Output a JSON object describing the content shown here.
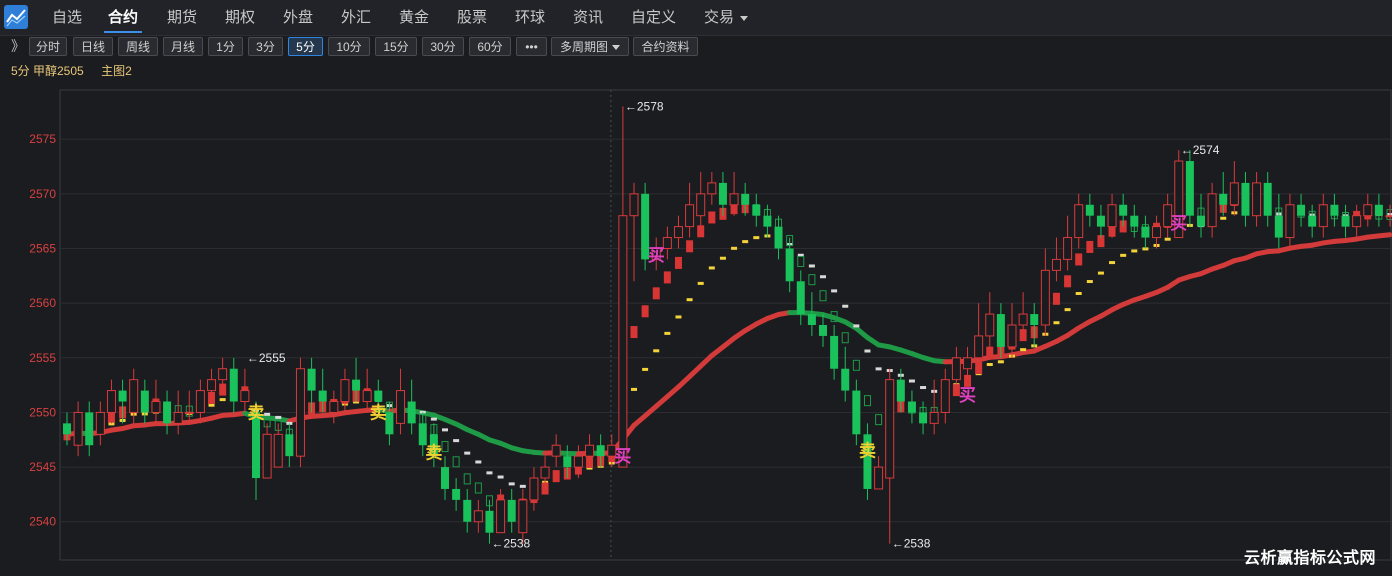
{
  "nav": {
    "items": [
      "自选",
      "合约",
      "期货",
      "期权",
      "外盘",
      "外汇",
      "黄金",
      "股票",
      "环球",
      "资讯",
      "自定义",
      "交易"
    ],
    "active": "合约"
  },
  "toolbar": {
    "expand_glyph": "》",
    "buttons": [
      "分时",
      "日线",
      "周线",
      "月线",
      "1分",
      "3分",
      "5分",
      "10分",
      "15分",
      "30分",
      "60分",
      "•••",
      "多周期图",
      "合约资料"
    ],
    "active": "5分"
  },
  "info": {
    "period_contract": "5分 甲醇2505",
    "main_chart": "主图2"
  },
  "chart_data": {
    "type": "candlestick",
    "y_ticks": [
      2540,
      2545,
      2550,
      2555,
      2560,
      2565,
      2570,
      2575
    ],
    "ylim": [
      2536.5,
      2579.5
    ],
    "grid": true,
    "annotations": [
      {
        "text": "←2555",
        "index": 16,
        "value": 2555
      },
      {
        "text": "←2578",
        "index": 50,
        "value": 2578
      },
      {
        "text": "←2538",
        "index": 38,
        "value": 2538
      },
      {
        "text": "←2538",
        "index": 74,
        "value": 2538
      },
      {
        "text": "←2574",
        "index": 100,
        "value": 2574
      }
    ],
    "signals": [
      {
        "text": "卖",
        "index": 17,
        "value": 2550.2,
        "type": "sell"
      },
      {
        "text": "卖",
        "index": 28,
        "value": 2550.2,
        "type": "sell"
      },
      {
        "text": "卖",
        "index": 33,
        "value": 2546.5,
        "type": "sell"
      },
      {
        "text": "买",
        "index": 50,
        "value": 2546.2,
        "type": "buy"
      },
      {
        "text": "买",
        "index": 53,
        "value": 2564.6,
        "type": "buy"
      },
      {
        "text": "卖",
        "index": 72,
        "value": 2546.7,
        "type": "sell"
      },
      {
        "text": "买",
        "index": 81,
        "value": 2551.8,
        "type": "buy"
      },
      {
        "text": "买",
        "index": 100,
        "value": 2567.5,
        "type": "buy"
      }
    ],
    "candles": [
      [
        2549,
        2548,
        2550,
        2547
      ],
      [
        2547,
        2550,
        2551,
        2546
      ],
      [
        2550,
        2547,
        2551,
        2546
      ],
      [
        2548,
        2550,
        2551,
        2547
      ],
      [
        2550,
        2552,
        2553,
        2549
      ],
      [
        2552,
        2551,
        2553,
        2549
      ],
      [
        2550,
        2553,
        2554,
        2549
      ],
      [
        2552,
        2550,
        2553,
        2549
      ],
      [
        2550,
        2551,
        2553,
        2549
      ],
      [
        2551,
        2549,
        2552,
        2548
      ],
      [
        2549,
        2550,
        2552,
        2548
      ],
      [
        2550,
        2550,
        2552,
        2549
      ],
      [
        2550,
        2552,
        2553,
        2549
      ],
      [
        2552,
        2553,
        2554,
        2551
      ],
      [
        2553,
        2554,
        2555,
        2552
      ],
      [
        2554,
        2551,
        2555,
        2550
      ],
      [
        2551,
        2552,
        2554,
        2550
      ],
      [
        2550,
        2544,
        2551,
        2542
      ],
      [
        2544,
        2548,
        2549,
        2544
      ],
      [
        2545,
        2548,
        2549,
        2545
      ],
      [
        2548,
        2546,
        2549,
        2545
      ],
      [
        2546,
        2554,
        2555,
        2545
      ],
      [
        2554,
        2552,
        2555,
        2550
      ],
      [
        2552,
        2551,
        2554,
        2550
      ],
      [
        2550,
        2551,
        2552,
        2549
      ],
      [
        2551,
        2553,
        2554,
        2550
      ],
      [
        2553,
        2552,
        2555,
        2551
      ],
      [
        2551,
        2552,
        2554,
        2550
      ],
      [
        2552,
        2551,
        2553,
        2550
      ],
      [
        2550,
        2548,
        2551,
        2547
      ],
      [
        2549,
        2552,
        2554,
        2548
      ],
      [
        2551,
        2549,
        2553,
        2548
      ],
      [
        2549,
        2547,
        2550,
        2546
      ],
      [
        2548,
        2546,
        2549,
        2545
      ],
      [
        2545,
        2543,
        2546,
        2542
      ],
      [
        2543,
        2542,
        2544,
        2541
      ],
      [
        2542,
        2540,
        2543,
        2539
      ],
      [
        2540,
        2541,
        2542,
        2539
      ],
      [
        2541,
        2539,
        2542,
        2538
      ],
      [
        2539,
        2542,
        2543,
        2539
      ],
      [
        2542,
        2540,
        2543,
        2539
      ],
      [
        2539,
        2542,
        2543,
        2538
      ],
      [
        2542,
        2544,
        2545,
        2541
      ],
      [
        2544,
        2545,
        2546,
        2543
      ],
      [
        2546,
        2547,
        2548,
        2545
      ],
      [
        2546,
        2545,
        2547,
        2544
      ],
      [
        2545,
        2546,
        2547,
        2544
      ],
      [
        2546,
        2547,
        2548,
        2545
      ],
      [
        2547,
        2546,
        2548,
        2545
      ],
      [
        2546,
        2547,
        2548,
        2545
      ],
      [
        2545,
        2568,
        2578,
        2545
      ],
      [
        2568,
        2570,
        2571,
        2562
      ],
      [
        2570,
        2564,
        2571,
        2563
      ],
      [
        2564,
        2565,
        2566,
        2563
      ],
      [
        2565,
        2566,
        2567,
        2564
      ],
      [
        2566,
        2567,
        2568,
        2565
      ],
      [
        2567,
        2569,
        2571,
        2566
      ],
      [
        2568,
        2570,
        2572,
        2567
      ],
      [
        2570,
        2571,
        2572,
        2569
      ],
      [
        2571,
        2569,
        2572,
        2568
      ],
      [
        2569,
        2570,
        2572,
        2568
      ],
      [
        2570,
        2569,
        2571,
        2568
      ],
      [
        2569,
        2568,
        2570,
        2567
      ],
      [
        2568,
        2567,
        2569,
        2566
      ],
      [
        2567,
        2565,
        2568,
        2564
      ],
      [
        2565,
        2562,
        2566,
        2561
      ],
      [
        2562,
        2559,
        2563,
        2558
      ],
      [
        2559,
        2558,
        2561,
        2557
      ],
      [
        2558,
        2557,
        2559,
        2556
      ],
      [
        2557,
        2554,
        2558,
        2553
      ],
      [
        2554,
        2552,
        2556,
        2551
      ],
      [
        2552,
        2548,
        2553,
        2547
      ],
      [
        2548,
        2543,
        2549,
        2542
      ],
      [
        2543,
        2545,
        2546,
        2544
      ],
      [
        2544,
        2553,
        2554,
        2538
      ],
      [
        2553,
        2551,
        2554,
        2550
      ],
      [
        2551,
        2550,
        2552,
        2549
      ],
      [
        2550,
        2549,
        2551,
        2548
      ],
      [
        2549,
        2550,
        2553,
        2548
      ],
      [
        2550,
        2553,
        2554,
        2549
      ],
      [
        2553,
        2555,
        2556,
        2552
      ],
      [
        2554,
        2555,
        2556,
        2553
      ],
      [
        2555,
        2557,
        2560,
        2554
      ],
      [
        2557,
        2559,
        2561,
        2556
      ],
      [
        2559,
        2556,
        2560,
        2555
      ],
      [
        2556,
        2558,
        2560,
        2555
      ],
      [
        2558,
        2559,
        2561,
        2557
      ],
      [
        2559,
        2558,
        2560,
        2556
      ],
      [
        2558,
        2563,
        2565,
        2557
      ],
      [
        2563,
        2564,
        2566,
        2562
      ],
      [
        2564,
        2566,
        2568,
        2563
      ],
      [
        2566,
        2569,
        2570,
        2565
      ],
      [
        2569,
        2568,
        2570,
        2567
      ],
      [
        2568,
        2567,
        2569,
        2566
      ],
      [
        2567,
        2569,
        2570,
        2566
      ],
      [
        2569,
        2568,
        2570,
        2567
      ],
      [
        2568,
        2567,
        2569,
        2566
      ],
      [
        2567,
        2566,
        2568,
        2565
      ],
      [
        2566,
        2567,
        2568,
        2565
      ],
      [
        2567,
        2569,
        2570,
        2566
      ],
      [
        2566,
        2573,
        2574,
        2566
      ],
      [
        2573,
        2568,
        2574,
        2567
      ],
      [
        2568,
        2567,
        2570,
        2566
      ],
      [
        2567,
        2570,
        2571,
        2566
      ],
      [
        2570,
        2569,
        2572,
        2568
      ],
      [
        2569,
        2571,
        2573,
        2568
      ],
      [
        2571,
        2568,
        2572,
        2567
      ],
      [
        2568,
        2571,
        2572,
        2567
      ],
      [
        2571,
        2568,
        2572,
        2567
      ],
      [
        2568,
        2566,
        2570,
        2565
      ],
      [
        2566,
        2569,
        2570,
        2565
      ],
      [
        2569,
        2568,
        2570,
        2567
      ],
      [
        2568,
        2567,
        2569,
        2566
      ],
      [
        2567,
        2569,
        2570,
        2566
      ],
      [
        2569,
        2568,
        2570,
        2567
      ],
      [
        2568,
        2567,
        2569,
        2566
      ],
      [
        2567,
        2568,
        2569,
        2566
      ],
      [
        2568,
        2569,
        2570,
        2567
      ],
      [
        2569,
        2568,
        2570,
        2567
      ],
      [
        2568,
        2568,
        2569,
        2567
      ]
    ]
  },
  "watermark": "云析赢指标公式网"
}
